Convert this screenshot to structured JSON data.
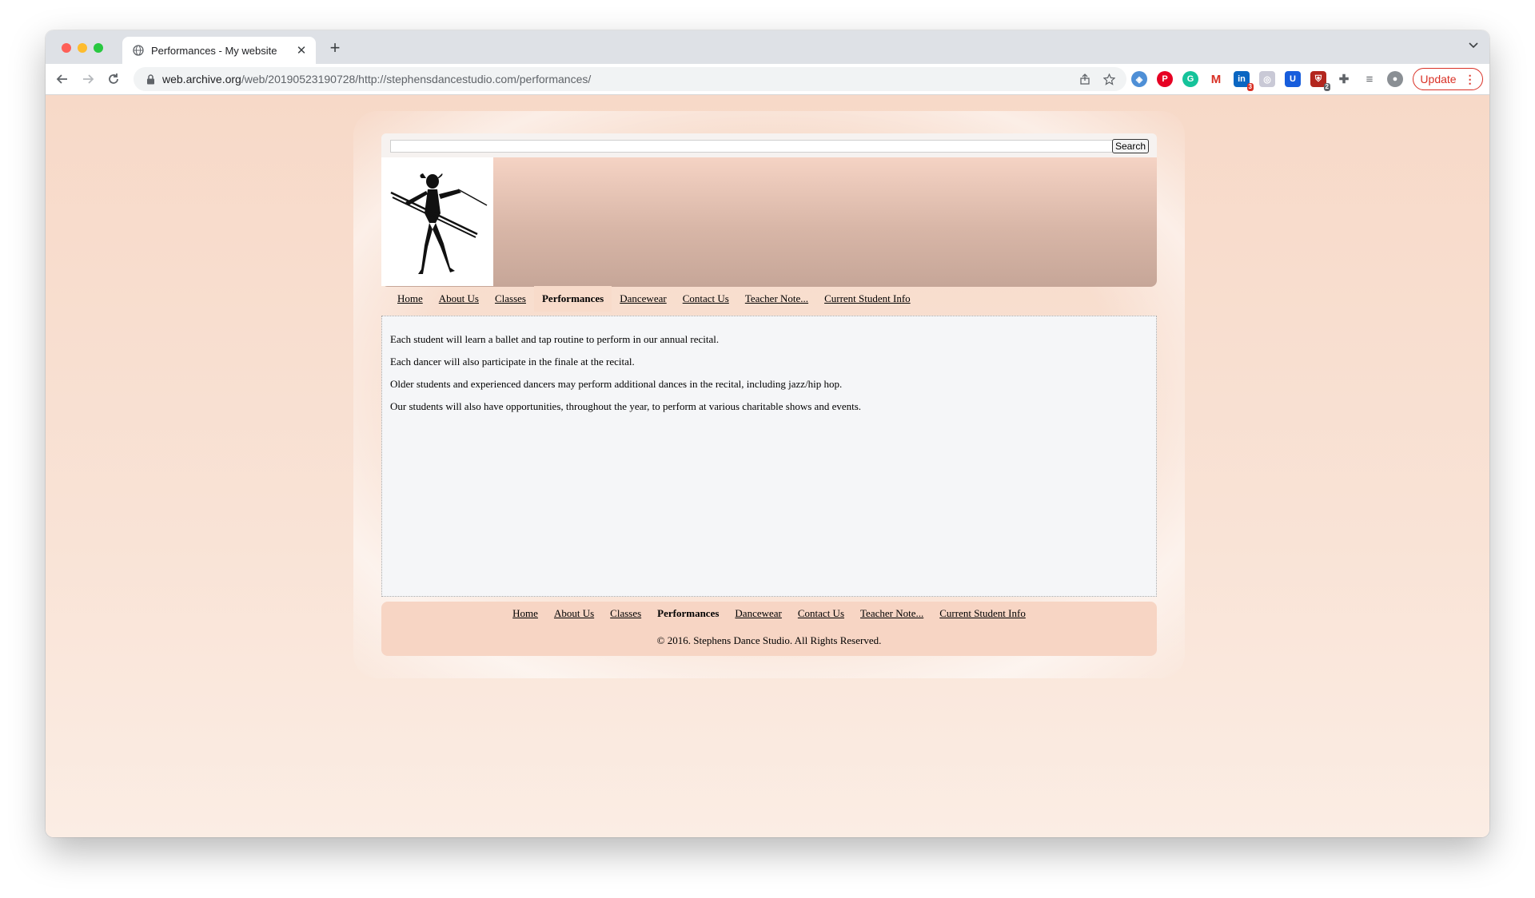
{
  "browser": {
    "tab_title": "Performances - My website",
    "new_tab_symbol": "+",
    "close_symbol": "✕",
    "url_host": "web.archive.org",
    "url_path": "/web/20190523190728/http://stephensdancestudio.com/performances/",
    "update_label": "Update",
    "extension_badges": {
      "linkedin": "3",
      "shield": "2"
    }
  },
  "search": {
    "value": "",
    "button_label": "Search"
  },
  "nav": {
    "items": [
      {
        "label": "Home"
      },
      {
        "label": "About Us"
      },
      {
        "label": "Classes"
      },
      {
        "label": "Performances",
        "active": true
      },
      {
        "label": "Dancewear"
      },
      {
        "label": "Contact Us"
      },
      {
        "label": "Teacher Note..."
      },
      {
        "label": "Current Student Info"
      }
    ]
  },
  "content": {
    "paragraphs": [
      "Each student will learn a ballet and tap routine to perform in our annual recital.",
      "Each dancer will also participate in the finale at the recital.",
      "Older students and experienced dancers may perform additional dances in the recital, including jazz/hip hop.",
      "Our students will also have opportunities, throughout the year, to perform at various charitable shows and events."
    ]
  },
  "footer": {
    "copyright": "© 2016. Stephens Dance Studio. All Rights Reserved."
  },
  "colors": {
    "page_bg": "#f7d9c8",
    "header_bg": "#d8b6a7",
    "active_tab": "#f8dbca",
    "update_red": "#d93025"
  }
}
